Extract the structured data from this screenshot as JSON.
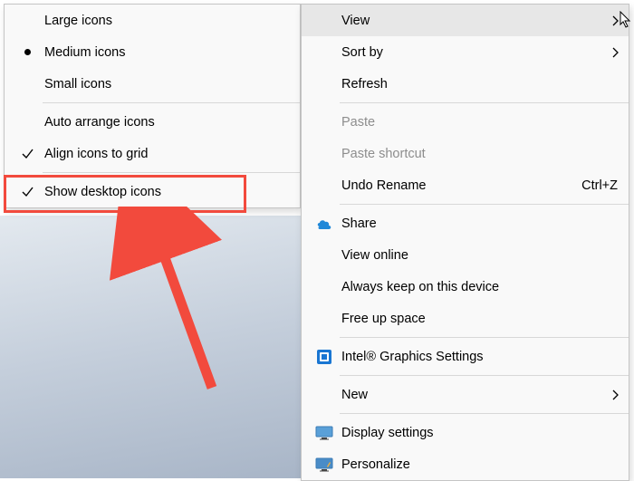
{
  "main_menu": {
    "view": "View",
    "sort_by": "Sort by",
    "refresh": "Refresh",
    "paste": "Paste",
    "paste_shortcut": "Paste shortcut",
    "undo_rename": "Undo Rename",
    "undo_rename_shortcut": "Ctrl+Z",
    "share": "Share",
    "view_online": "View online",
    "always_keep": "Always keep on this device",
    "free_up": "Free up space",
    "intel_graphics": "Intel® Graphics Settings",
    "new": "New",
    "display_settings": "Display settings",
    "personalize": "Personalize"
  },
  "view_submenu": {
    "large_icons": "Large icons",
    "medium_icons": "Medium icons",
    "small_icons": "Small icons",
    "auto_arrange": "Auto arrange icons",
    "align_grid": "Align icons to grid",
    "show_desktop": "Show desktop icons"
  }
}
